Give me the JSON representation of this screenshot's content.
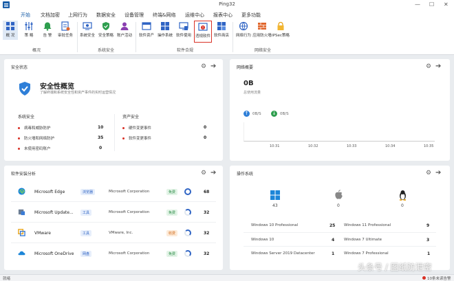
{
  "window": {
    "title": "Ping32",
    "minimize": "—",
    "maximize": "☐",
    "close": "✕"
  },
  "menu": [
    "开始",
    "文档加密",
    "上网行为",
    "数据安全",
    "设备管理",
    "终端&网络",
    "运维中心",
    "报表中心",
    "更多功能"
  ],
  "ribbon": {
    "buttons": [
      {
        "name": "overview",
        "label": "概 况"
      },
      {
        "name": "strategy",
        "label": "策 略"
      },
      {
        "name": "alarm",
        "label": "告 警"
      },
      {
        "name": "audit",
        "label": "审批任务"
      },
      {
        "name": "sys-security",
        "label": "系统安全"
      },
      {
        "name": "sec-policy",
        "label": "安全策略"
      },
      {
        "name": "account-activity",
        "label": "账户活动"
      },
      {
        "name": "software-assets",
        "label": "软件资产"
      },
      {
        "name": "os",
        "label": "操作系统"
      },
      {
        "name": "software-usage",
        "label": "软件使用"
      },
      {
        "name": "illegal-software",
        "label": "违规软件"
      },
      {
        "name": "software-store",
        "label": "软件商店"
      },
      {
        "name": "net-behavior",
        "label": "网络行为"
      },
      {
        "name": "app-firewall",
        "label": "应用防火墙"
      },
      {
        "name": "ipsec",
        "label": "IPSec策略"
      }
    ],
    "groups": [
      "概况",
      "系统安全",
      "软件合规",
      "网络安全"
    ]
  },
  "security": {
    "title": "安全状态",
    "overview_title": "安全性概览",
    "overview_desc": "了解终端和系统安全性和资产事件的实时运营情况",
    "sys_title": "系统安全",
    "asset_title": "资产安全",
    "sys_items": [
      {
        "label": "病毒和威胁防护",
        "value": "10"
      },
      {
        "label": "防火墙和网络防护",
        "value": "35"
      },
      {
        "label": "未使用密码账户",
        "value": "0"
      }
    ],
    "asset_items": [
      {
        "label": "硬件变更事件",
        "value": "0"
      },
      {
        "label": "软件变更事件",
        "value": "0"
      }
    ]
  },
  "network": {
    "title": "网络概要",
    "total": "0B",
    "total_label": "总使用流量",
    "up": "0B/S",
    "down": "0B/S",
    "times": [
      "10:31",
      "10:32",
      "10:33",
      "10:34",
      "10:35"
    ]
  },
  "software": {
    "title": "软件安装分析",
    "rows": [
      {
        "name": "Microsoft Edge",
        "tag": "浏览器",
        "tag_color": "blue",
        "vendor": "Microsoft Corporation",
        "lic": "免费",
        "lic_color": "green",
        "count": "68"
      },
      {
        "name": "Microsoft Update...",
        "tag": "工具",
        "tag_color": "blue",
        "vendor": "Microsoft Corporation",
        "lic": "免费",
        "lic_color": "green",
        "count": "32"
      },
      {
        "name": "VMware",
        "tag": "工具",
        "tag_color": "blue",
        "vendor": "VMware, Inc.",
        "lic": "收费",
        "lic_color": "orange",
        "count": "32"
      },
      {
        "name": "Microsoft OneDrive",
        "tag": "网盘",
        "tag_color": "blue",
        "vendor": "Microsoft Corporation",
        "lic": "免费",
        "lic_color": "green",
        "count": "32"
      }
    ]
  },
  "os": {
    "title": "操作系统",
    "platforms": [
      {
        "name": "windows-icon",
        "count": "43"
      },
      {
        "name": "apple-icon",
        "count": "0"
      },
      {
        "name": "linux-icon",
        "count": "0"
      }
    ],
    "left": [
      {
        "label": "Windows 10 Professional",
        "value": "25"
      },
      {
        "label": "Windows 10",
        "value": "4"
      },
      {
        "label": "Windows Server 2019 Datacenter",
        "value": "1"
      }
    ],
    "right": [
      {
        "label": "Windows 11 Professional",
        "value": "9"
      },
      {
        "label": "Windows 7 Ultimate",
        "value": "3"
      },
      {
        "label": "Windows 7 Professional",
        "value": "1"
      }
    ]
  },
  "status": {
    "left": "就绪",
    "right": "10条未读告警"
  },
  "watermark": "头条号 / 图纸防泄密"
}
